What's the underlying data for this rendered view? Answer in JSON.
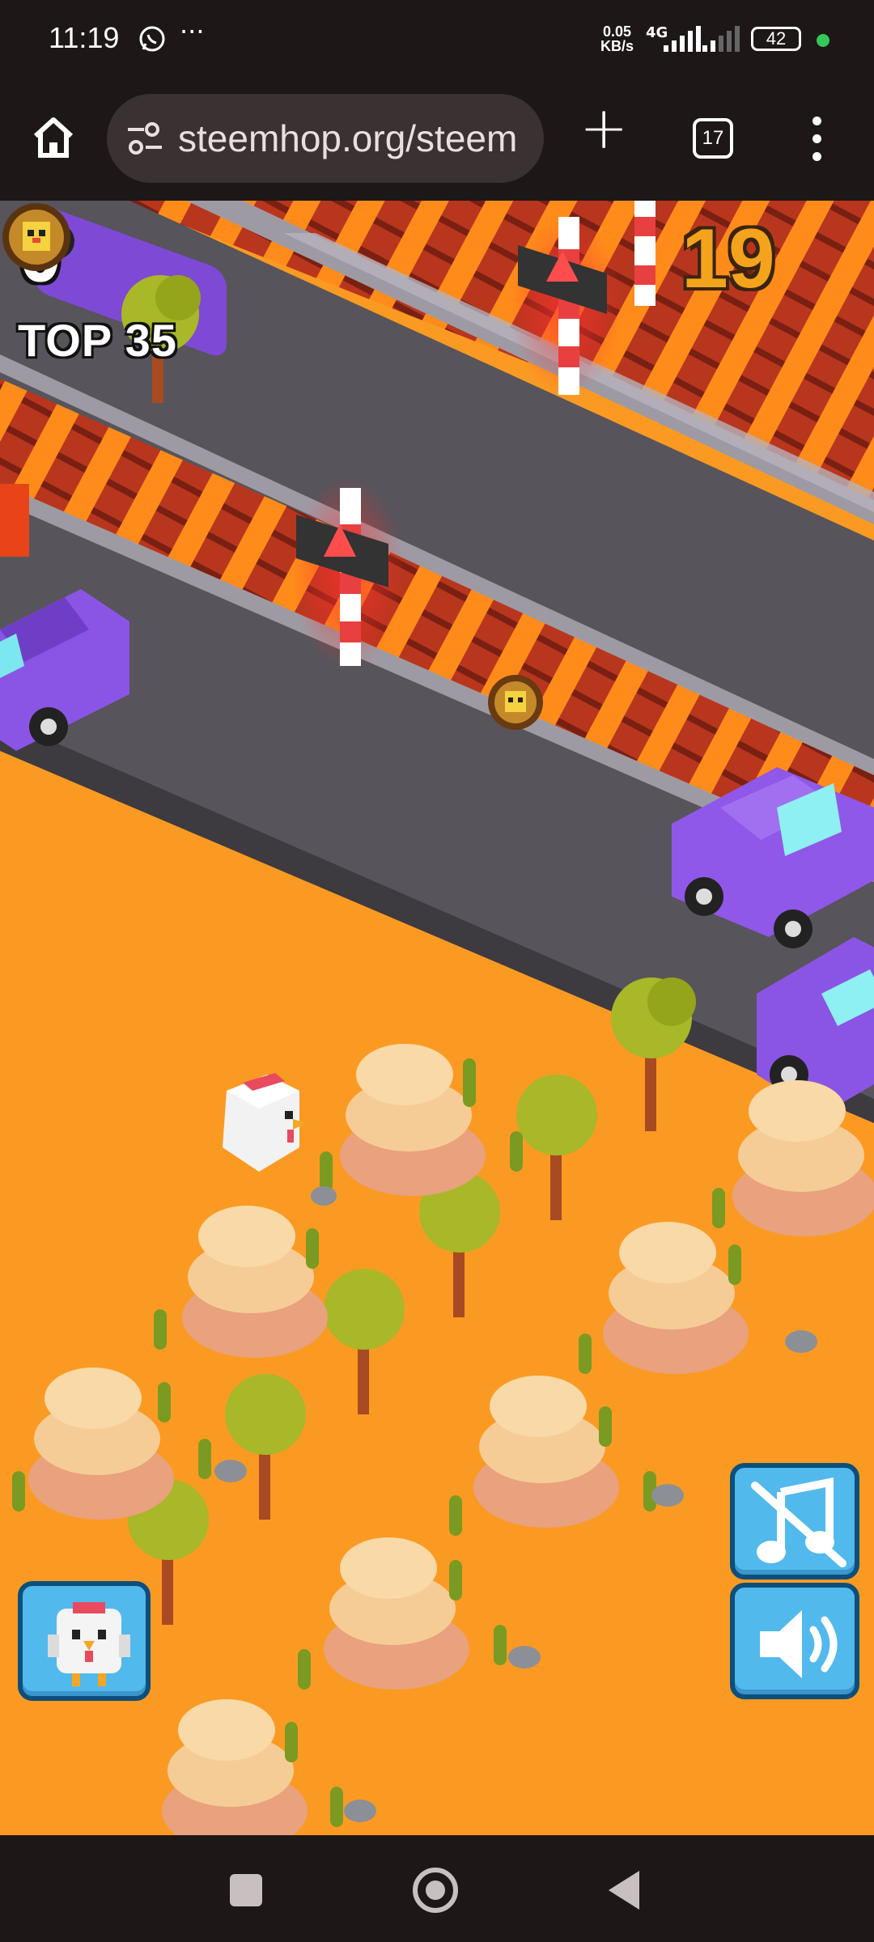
{
  "status_bar": {
    "time": "11:19",
    "speed_value": "0.05",
    "speed_unit": "KB/s",
    "network": "4G",
    "battery": "42",
    "icons": [
      "whatsapp-icon",
      "more-notifications-icon",
      "signal-icon",
      "battery-icon"
    ]
  },
  "browser": {
    "url": "steemhop.org/steem",
    "tab_count": "17",
    "icons": [
      "home-icon",
      "site-settings-icon",
      "new-tab-icon",
      "tabs-icon",
      "menu-icon"
    ]
  },
  "game": {
    "score": "0",
    "top_label": "TOP 35",
    "coins": "19",
    "buttons": [
      "character-select",
      "music-muted",
      "sound-on"
    ],
    "colors": {
      "ground": "#fb9a22",
      "road": "#57545b",
      "car": "#8f58e8",
      "button": "#52b9ec",
      "coin_text": "#f4a41c"
    }
  },
  "nav_bar": {
    "icons": [
      "recents-icon",
      "home-circle-icon",
      "back-icon"
    ]
  }
}
